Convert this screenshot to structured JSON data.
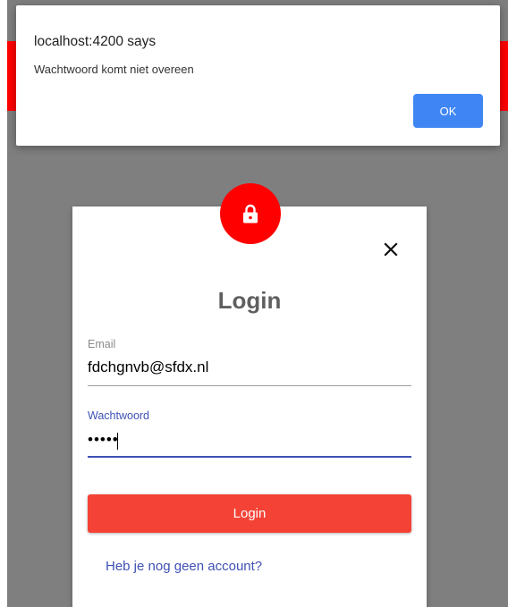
{
  "alert": {
    "title": "localhost:4200 says",
    "message": "Wachtwoord komt niet overeen",
    "ok_label": "OK"
  },
  "login": {
    "title": "Login",
    "email_label": "Email",
    "email_value": "fdchgnvb@sfdx.nl",
    "password_label": "Wachtwoord",
    "password_value": "•••••",
    "submit_label": "Login",
    "register_link": "Heb je nog geen account?"
  },
  "icons": {
    "badge": "lock-icon",
    "close": "close-icon"
  },
  "colors": {
    "header_red": "#ff0000",
    "backdrop": "#7f7f7f",
    "button_red": "#f44336",
    "accent_indigo": "#3f51b5",
    "alert_ok_blue": "#3f86f4"
  }
}
